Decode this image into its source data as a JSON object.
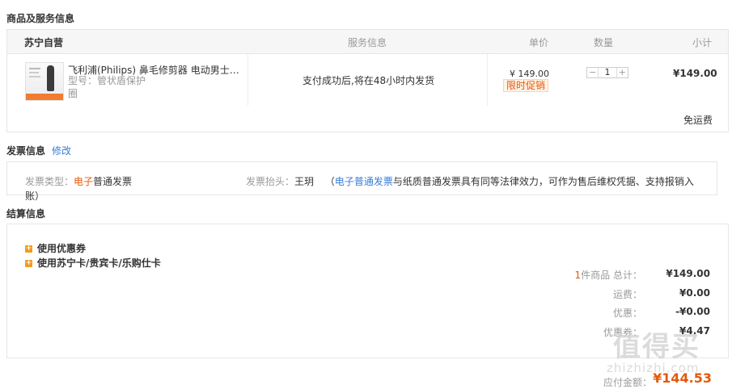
{
  "goods_section": {
    "title": "商品及服务信息"
  },
  "table_header": {
    "store": "苏宁自营",
    "service": "服务信息",
    "price": "单价",
    "qty": "数量",
    "subtotal": "小计"
  },
  "item": {
    "name": "飞利浦(Philips) 鼻毛修剪器 电动男士…",
    "model_prefix": "型号：",
    "model": "管状盾保护",
    "model_line2": "圈",
    "service": "支付成功后,将在48小时内发货",
    "price": "¥ 149.00",
    "promo": "限时促销",
    "qty": "1",
    "qty_minus": "−",
    "qty_plus": "+",
    "subtotal": "¥149.00"
  },
  "shipping_note": "免运费",
  "invoice": {
    "title": "发票信息",
    "edit": "修改",
    "type_label": "发票类型：",
    "type_highlight": "电子",
    "type_rest": "普通发票",
    "head_label": "发票抬头：",
    "head_value": "王玥",
    "note_open": "（",
    "note_link": "电子普通发票",
    "note_rest": "与纸质普通发票具有同等法律效力，可作为售后维权凭据、支持报销入",
    "note_line2": "账）"
  },
  "settlement": {
    "title": "结算信息",
    "coupon": "使用优惠券",
    "cards": "使用苏宁卡/贵宾卡/乐购仕卡",
    "count": "1",
    "count_suffix": "件商品 总计：",
    "total": "¥149.00",
    "freight_label": "运费：",
    "freight": "¥0.00",
    "discount_label": "优惠：",
    "discount": "-¥0.00",
    "coupon_label": "优惠券：",
    "coupon_value": "¥4.47",
    "payable_label": "应付金额：",
    "payable": "¥144.53"
  },
  "watermark": {
    "text": "值得买",
    "url": "zhizhizhi.com"
  },
  "colors": {
    "orange": "#e4580b",
    "blue": "#3a7bd5",
    "header_bg": "#f6f6f6"
  }
}
